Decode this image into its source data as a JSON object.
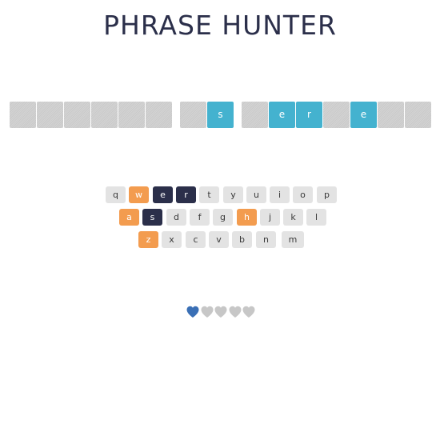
{
  "title": "PHRASE HUNTER",
  "phrase": [
    {
      "letter": "",
      "revealed": false
    },
    {
      "letter": "",
      "revealed": false
    },
    {
      "letter": "",
      "revealed": false
    },
    {
      "letter": "",
      "revealed": false
    },
    {
      "letter": "",
      "revealed": false
    },
    {
      "letter": "",
      "revealed": false
    },
    {
      "space": true
    },
    {
      "letter": "",
      "revealed": false
    },
    {
      "letter": "s",
      "revealed": true
    },
    {
      "space": true
    },
    {
      "letter": "",
      "revealed": false
    },
    {
      "letter": "e",
      "revealed": true
    },
    {
      "letter": "r",
      "revealed": true
    },
    {
      "letter": "",
      "revealed": false
    },
    {
      "letter": "e",
      "revealed": true
    },
    {
      "letter": "",
      "revealed": false
    },
    {
      "letter": "",
      "revealed": false
    }
  ],
  "keyboard": {
    "rows": [
      [
        {
          "key": "q",
          "state": "unused"
        },
        {
          "key": "w",
          "state": "wrong"
        },
        {
          "key": "e",
          "state": "chosen"
        },
        {
          "key": "r",
          "state": "chosen"
        },
        {
          "key": "t",
          "state": "unused"
        },
        {
          "key": "y",
          "state": "unused"
        },
        {
          "key": "u",
          "state": "unused"
        },
        {
          "key": "i",
          "state": "unused"
        },
        {
          "key": "o",
          "state": "unused"
        },
        {
          "key": "p",
          "state": "unused"
        }
      ],
      [
        {
          "key": "a",
          "state": "wrong"
        },
        {
          "key": "s",
          "state": "chosen"
        },
        {
          "key": "d",
          "state": "unused"
        },
        {
          "key": "f",
          "state": "unused"
        },
        {
          "key": "g",
          "state": "unused"
        },
        {
          "key": "h",
          "state": "wrong"
        },
        {
          "key": "j",
          "state": "unused"
        },
        {
          "key": "k",
          "state": "unused"
        },
        {
          "key": "l",
          "state": "unused"
        }
      ],
      [
        {
          "key": "z",
          "state": "wrong"
        },
        {
          "key": "x",
          "state": "unused"
        },
        {
          "key": "c",
          "state": "unused"
        },
        {
          "key": "v",
          "state": "unused"
        },
        {
          "key": "b",
          "state": "unused"
        },
        {
          "key": "n",
          "state": "unused"
        },
        {
          "key": "m",
          "state": "unused"
        }
      ]
    ]
  },
  "lives": {
    "total": 5,
    "remaining": 1,
    "icon": "heart-icon",
    "live_color": "#3a6fb5",
    "lost_color": "#c7c7c7"
  },
  "colors": {
    "title": "#2b2f4a",
    "tile_hidden": "#cfcfcf",
    "tile_revealed": "#44b2cf",
    "key_unused": "#e3e3e3",
    "key_wrong": "#f39c4f",
    "key_chosen": "#2b2f4a"
  }
}
